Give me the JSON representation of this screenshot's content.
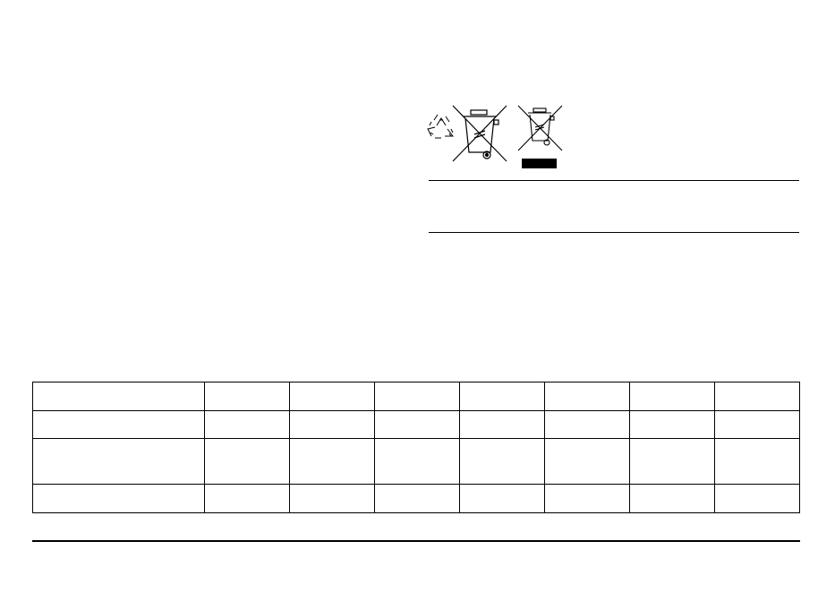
{
  "icons": {
    "recycle": "recycle-icon",
    "weee_bin": "crossed-out-wheelie-bin-icon",
    "weee_bin_bar": "crossed-out-wheelie-bin-with-bar-icon"
  },
  "table": {
    "rows": [
      [
        "",
        "",
        "",
        "",
        "",
        "",
        "",
        ""
      ],
      [
        "",
        "",
        "",
        "",
        "",
        "",
        "",
        ""
      ],
      [
        "",
        "",
        "",
        "",
        "",
        "",
        "",
        ""
      ],
      [
        "",
        "",
        "",
        "",
        "",
        "",
        "",
        ""
      ]
    ]
  },
  "colors": {
    "ink": "#000000",
    "paper": "#ffffff"
  }
}
